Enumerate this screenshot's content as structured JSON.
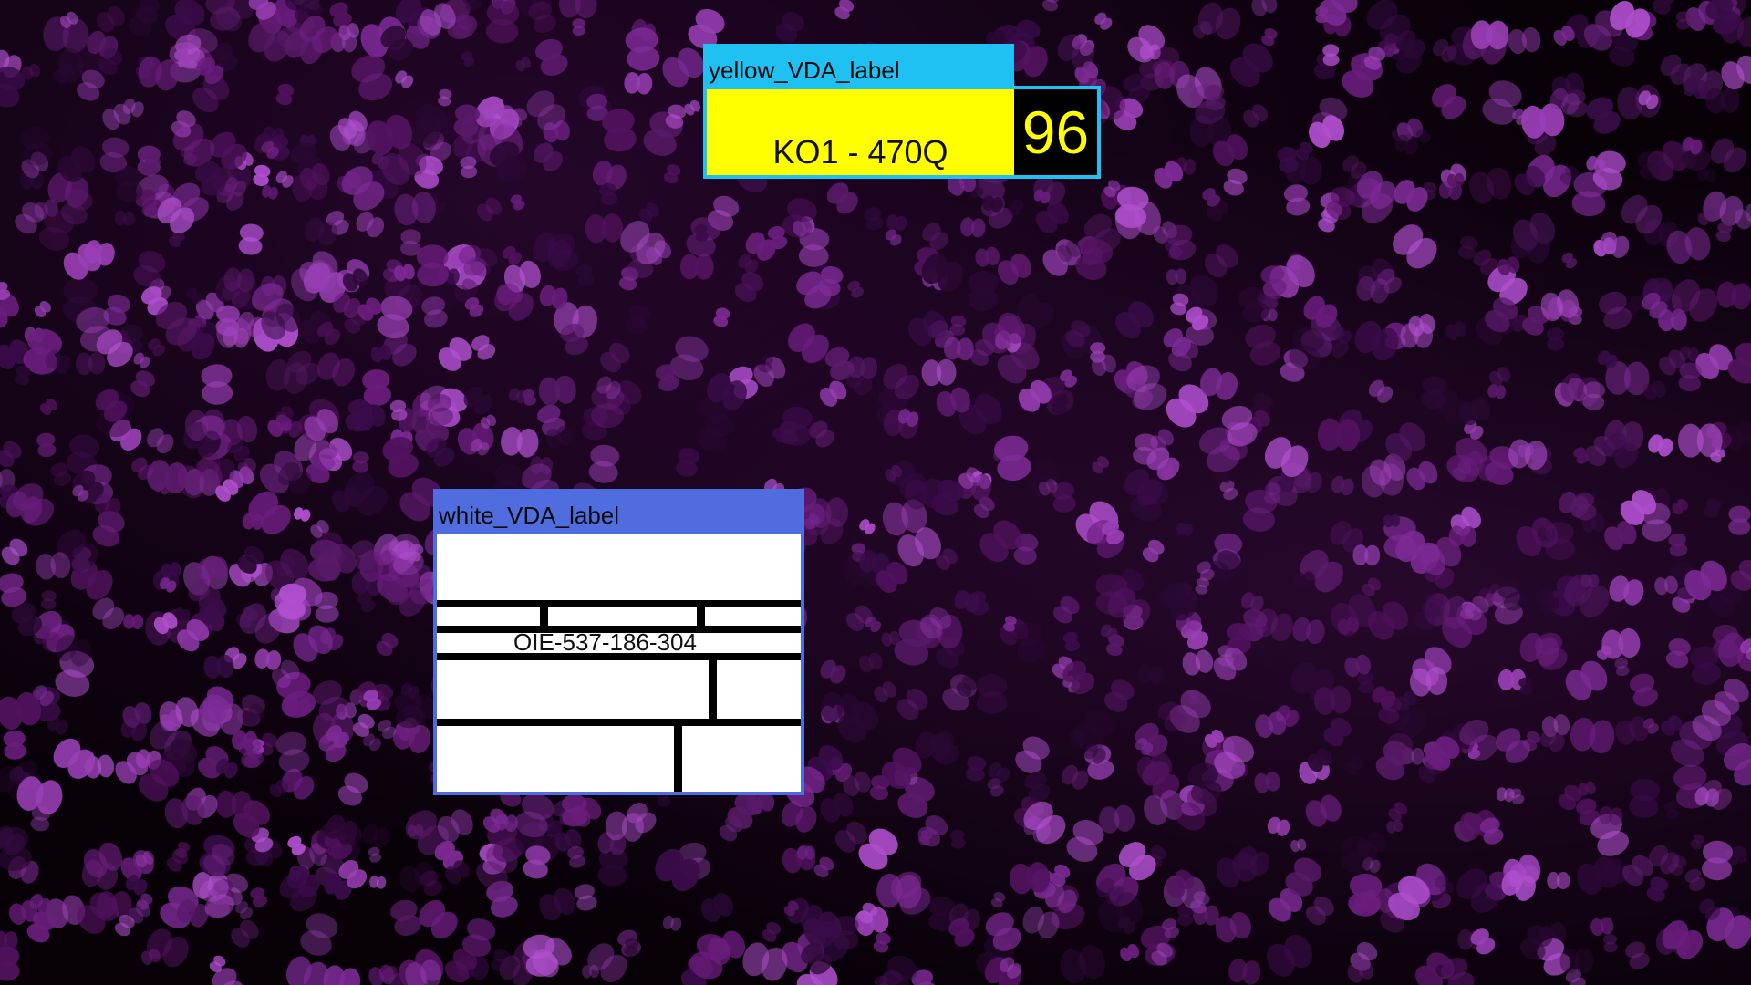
{
  "detections": [
    {
      "class_label": "yellow_VDA_label",
      "plate_text": "KO1 - 470Q",
      "score": "96",
      "colors": {
        "tag": "#1ec1f2",
        "plate": "#ffff00",
        "score_text": "#ffff00"
      }
    },
    {
      "class_label": "white_VDA_label",
      "plate_text": "OIE-537-186-304",
      "colors": {
        "tag": "#4f6ddf",
        "plate": "#ffffff"
      }
    }
  ],
  "background": {
    "description_icon": "purple-leaves-background",
    "colors": {
      "base": "#080108",
      "leaf": "#8a2fb0"
    }
  }
}
